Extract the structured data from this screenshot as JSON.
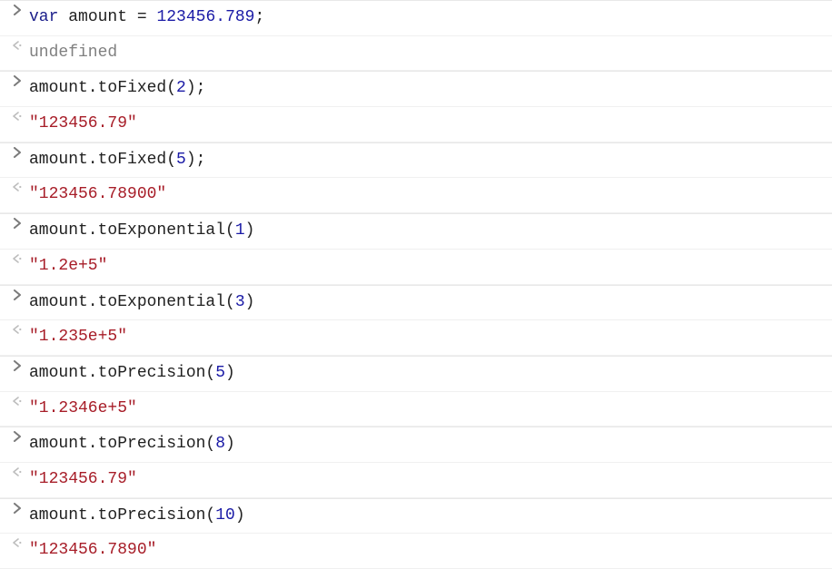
{
  "entries": [
    {
      "input": {
        "tokens": [
          {
            "t": "var ",
            "c": "tok-keyword"
          },
          {
            "t": "amount ",
            "c": "tok-ident"
          },
          {
            "t": "= ",
            "c": "tok-punct"
          },
          {
            "t": "123456.789",
            "c": "tok-number"
          },
          {
            "t": ";",
            "c": "tok-punct"
          }
        ]
      },
      "output": {
        "tokens": [
          {
            "t": "undefined",
            "c": "tok-undef"
          }
        ]
      }
    },
    {
      "input": {
        "tokens": [
          {
            "t": "amount.toFixed(",
            "c": "tok-ident"
          },
          {
            "t": "2",
            "c": "tok-number"
          },
          {
            "t": ");",
            "c": "tok-ident"
          }
        ]
      },
      "output": {
        "tokens": [
          {
            "t": "\"123456.79\"",
            "c": "tok-string"
          }
        ]
      }
    },
    {
      "input": {
        "tokens": [
          {
            "t": "amount.toFixed(",
            "c": "tok-ident"
          },
          {
            "t": "5",
            "c": "tok-number"
          },
          {
            "t": ");",
            "c": "tok-ident"
          }
        ]
      },
      "output": {
        "tokens": [
          {
            "t": "\"123456.78900\"",
            "c": "tok-string"
          }
        ]
      }
    },
    {
      "input": {
        "tokens": [
          {
            "t": "amount.toExponential(",
            "c": "tok-ident"
          },
          {
            "t": "1",
            "c": "tok-number"
          },
          {
            "t": ")",
            "c": "tok-ident"
          }
        ]
      },
      "output": {
        "tokens": [
          {
            "t": "\"1.2e+5\"",
            "c": "tok-string"
          }
        ]
      }
    },
    {
      "input": {
        "tokens": [
          {
            "t": "amount.toExponential(",
            "c": "tok-ident"
          },
          {
            "t": "3",
            "c": "tok-number"
          },
          {
            "t": ")",
            "c": "tok-ident"
          }
        ]
      },
      "output": {
        "tokens": [
          {
            "t": "\"1.235e+5\"",
            "c": "tok-string"
          }
        ]
      }
    },
    {
      "input": {
        "tokens": [
          {
            "t": "amount.toPrecision(",
            "c": "tok-ident"
          },
          {
            "t": "5",
            "c": "tok-number"
          },
          {
            "t": ")",
            "c": "tok-ident"
          }
        ]
      },
      "output": {
        "tokens": [
          {
            "t": "\"1.2346e+5\"",
            "c": "tok-string"
          }
        ]
      }
    },
    {
      "input": {
        "tokens": [
          {
            "t": "amount.toPrecision(",
            "c": "tok-ident"
          },
          {
            "t": "8",
            "c": "tok-number"
          },
          {
            "t": ")",
            "c": "tok-ident"
          }
        ]
      },
      "output": {
        "tokens": [
          {
            "t": "\"123456.79\"",
            "c": "tok-string"
          }
        ]
      }
    },
    {
      "input": {
        "tokens": [
          {
            "t": "amount.toPrecision(",
            "c": "tok-ident"
          },
          {
            "t": "10",
            "c": "tok-number"
          },
          {
            "t": ")",
            "c": "tok-ident"
          }
        ]
      },
      "output": {
        "tokens": [
          {
            "t": "\"123456.7890\"",
            "c": "tok-string"
          }
        ]
      }
    }
  ]
}
